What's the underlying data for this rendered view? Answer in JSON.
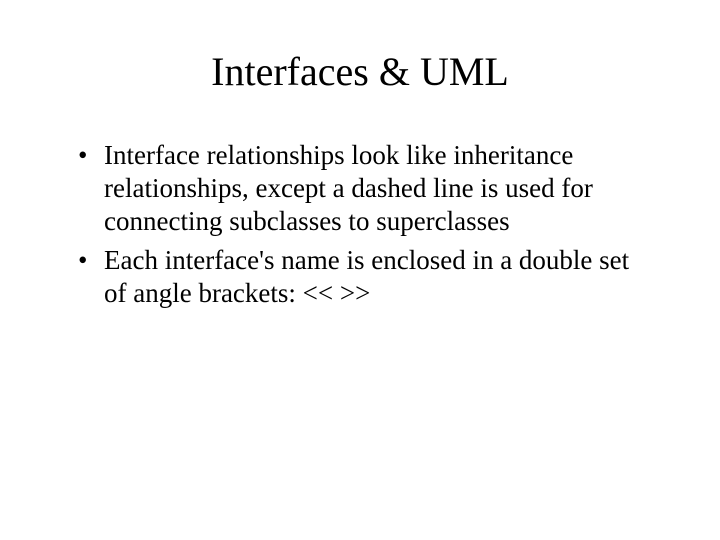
{
  "title": "Interfaces & UML",
  "bullets": [
    "Interface relationships look like inheritance relationships, except a dashed line is used for connecting subclasses to superclasses",
    "Each interface's name is enclosed in a double set of angle brackets: << >>"
  ]
}
